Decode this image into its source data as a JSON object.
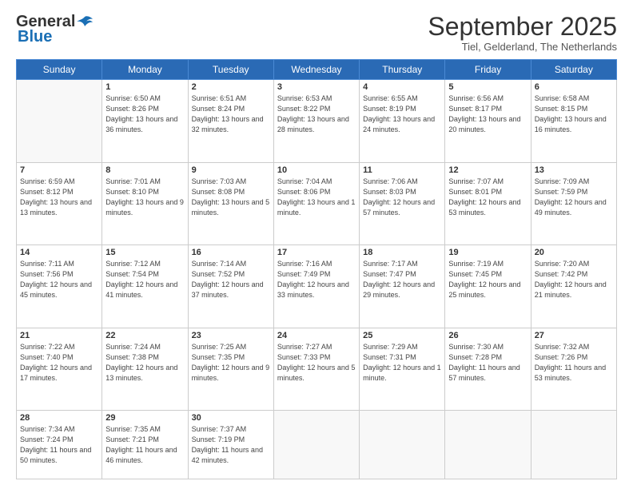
{
  "header": {
    "logo_general": "General",
    "logo_blue": "Blue",
    "month_title": "September 2025",
    "subtitle": "Tiel, Gelderland, The Netherlands"
  },
  "weekdays": [
    "Sunday",
    "Monday",
    "Tuesday",
    "Wednesday",
    "Thursday",
    "Friday",
    "Saturday"
  ],
  "weeks": [
    [
      {
        "day": "",
        "info": ""
      },
      {
        "day": "1",
        "info": "Sunrise: 6:50 AM\nSunset: 8:26 PM\nDaylight: 13 hours\nand 36 minutes."
      },
      {
        "day": "2",
        "info": "Sunrise: 6:51 AM\nSunset: 8:24 PM\nDaylight: 13 hours\nand 32 minutes."
      },
      {
        "day": "3",
        "info": "Sunrise: 6:53 AM\nSunset: 8:22 PM\nDaylight: 13 hours\nand 28 minutes."
      },
      {
        "day": "4",
        "info": "Sunrise: 6:55 AM\nSunset: 8:19 PM\nDaylight: 13 hours\nand 24 minutes."
      },
      {
        "day": "5",
        "info": "Sunrise: 6:56 AM\nSunset: 8:17 PM\nDaylight: 13 hours\nand 20 minutes."
      },
      {
        "day": "6",
        "info": "Sunrise: 6:58 AM\nSunset: 8:15 PM\nDaylight: 13 hours\nand 16 minutes."
      }
    ],
    [
      {
        "day": "7",
        "info": "Sunrise: 6:59 AM\nSunset: 8:12 PM\nDaylight: 13 hours\nand 13 minutes."
      },
      {
        "day": "8",
        "info": "Sunrise: 7:01 AM\nSunset: 8:10 PM\nDaylight: 13 hours\nand 9 minutes."
      },
      {
        "day": "9",
        "info": "Sunrise: 7:03 AM\nSunset: 8:08 PM\nDaylight: 13 hours\nand 5 minutes."
      },
      {
        "day": "10",
        "info": "Sunrise: 7:04 AM\nSunset: 8:06 PM\nDaylight: 13 hours\nand 1 minute."
      },
      {
        "day": "11",
        "info": "Sunrise: 7:06 AM\nSunset: 8:03 PM\nDaylight: 12 hours\nand 57 minutes."
      },
      {
        "day": "12",
        "info": "Sunrise: 7:07 AM\nSunset: 8:01 PM\nDaylight: 12 hours\nand 53 minutes."
      },
      {
        "day": "13",
        "info": "Sunrise: 7:09 AM\nSunset: 7:59 PM\nDaylight: 12 hours\nand 49 minutes."
      }
    ],
    [
      {
        "day": "14",
        "info": "Sunrise: 7:11 AM\nSunset: 7:56 PM\nDaylight: 12 hours\nand 45 minutes."
      },
      {
        "day": "15",
        "info": "Sunrise: 7:12 AM\nSunset: 7:54 PM\nDaylight: 12 hours\nand 41 minutes."
      },
      {
        "day": "16",
        "info": "Sunrise: 7:14 AM\nSunset: 7:52 PM\nDaylight: 12 hours\nand 37 minutes."
      },
      {
        "day": "17",
        "info": "Sunrise: 7:16 AM\nSunset: 7:49 PM\nDaylight: 12 hours\nand 33 minutes."
      },
      {
        "day": "18",
        "info": "Sunrise: 7:17 AM\nSunset: 7:47 PM\nDaylight: 12 hours\nand 29 minutes."
      },
      {
        "day": "19",
        "info": "Sunrise: 7:19 AM\nSunset: 7:45 PM\nDaylight: 12 hours\nand 25 minutes."
      },
      {
        "day": "20",
        "info": "Sunrise: 7:20 AM\nSunset: 7:42 PM\nDaylight: 12 hours\nand 21 minutes."
      }
    ],
    [
      {
        "day": "21",
        "info": "Sunrise: 7:22 AM\nSunset: 7:40 PM\nDaylight: 12 hours\nand 17 minutes."
      },
      {
        "day": "22",
        "info": "Sunrise: 7:24 AM\nSunset: 7:38 PM\nDaylight: 12 hours\nand 13 minutes."
      },
      {
        "day": "23",
        "info": "Sunrise: 7:25 AM\nSunset: 7:35 PM\nDaylight: 12 hours\nand 9 minutes."
      },
      {
        "day": "24",
        "info": "Sunrise: 7:27 AM\nSunset: 7:33 PM\nDaylight: 12 hours\nand 5 minutes."
      },
      {
        "day": "25",
        "info": "Sunrise: 7:29 AM\nSunset: 7:31 PM\nDaylight: 12 hours\nand 1 minute."
      },
      {
        "day": "26",
        "info": "Sunrise: 7:30 AM\nSunset: 7:28 PM\nDaylight: 11 hours\nand 57 minutes."
      },
      {
        "day": "27",
        "info": "Sunrise: 7:32 AM\nSunset: 7:26 PM\nDaylight: 11 hours\nand 53 minutes."
      }
    ],
    [
      {
        "day": "28",
        "info": "Sunrise: 7:34 AM\nSunset: 7:24 PM\nDaylight: 11 hours\nand 50 minutes."
      },
      {
        "day": "29",
        "info": "Sunrise: 7:35 AM\nSunset: 7:21 PM\nDaylight: 11 hours\nand 46 minutes."
      },
      {
        "day": "30",
        "info": "Sunrise: 7:37 AM\nSunset: 7:19 PM\nDaylight: 11 hours\nand 42 minutes."
      },
      {
        "day": "",
        "info": ""
      },
      {
        "day": "",
        "info": ""
      },
      {
        "day": "",
        "info": ""
      },
      {
        "day": "",
        "info": ""
      }
    ]
  ]
}
